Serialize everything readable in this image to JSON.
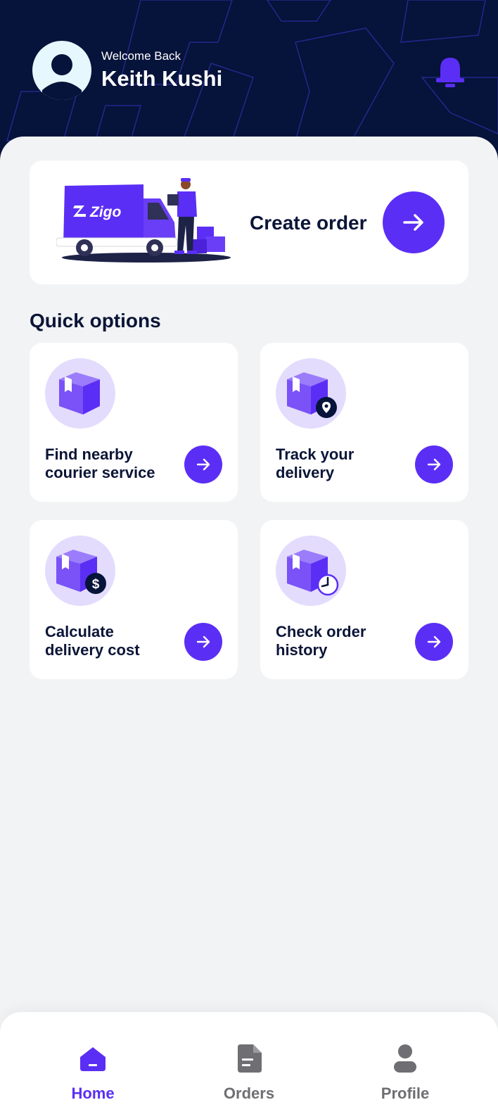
{
  "header": {
    "welcome_text": "Welcome Back",
    "user_name": "Keith Kushi"
  },
  "create_order": {
    "label": "Create order",
    "truck_brand": "Zigo"
  },
  "quick_options": {
    "title": "Quick options",
    "items": [
      {
        "line1": "Find nearby",
        "line2": "courier service",
        "icon": "box-icon"
      },
      {
        "line1": "Track your",
        "line2": "delivery",
        "icon": "box-location-icon"
      },
      {
        "line1": "Calculate",
        "line2": "delivery cost",
        "icon": "box-dollar-icon"
      },
      {
        "line1": "Check order",
        "line2": "history",
        "icon": "box-clock-icon"
      }
    ]
  },
  "nav": {
    "items": [
      {
        "label": "Home",
        "icon": "home-icon",
        "active": true
      },
      {
        "label": "Orders",
        "icon": "orders-icon",
        "active": false
      },
      {
        "label": "Profile",
        "icon": "profile-icon",
        "active": false
      }
    ]
  },
  "colors": {
    "header_bg": "#06133a",
    "accent": "#5b2ef5",
    "accent_light": "#e3dcfd",
    "text_dark": "#0b1537",
    "nav_inactive": "#6e6e73"
  }
}
